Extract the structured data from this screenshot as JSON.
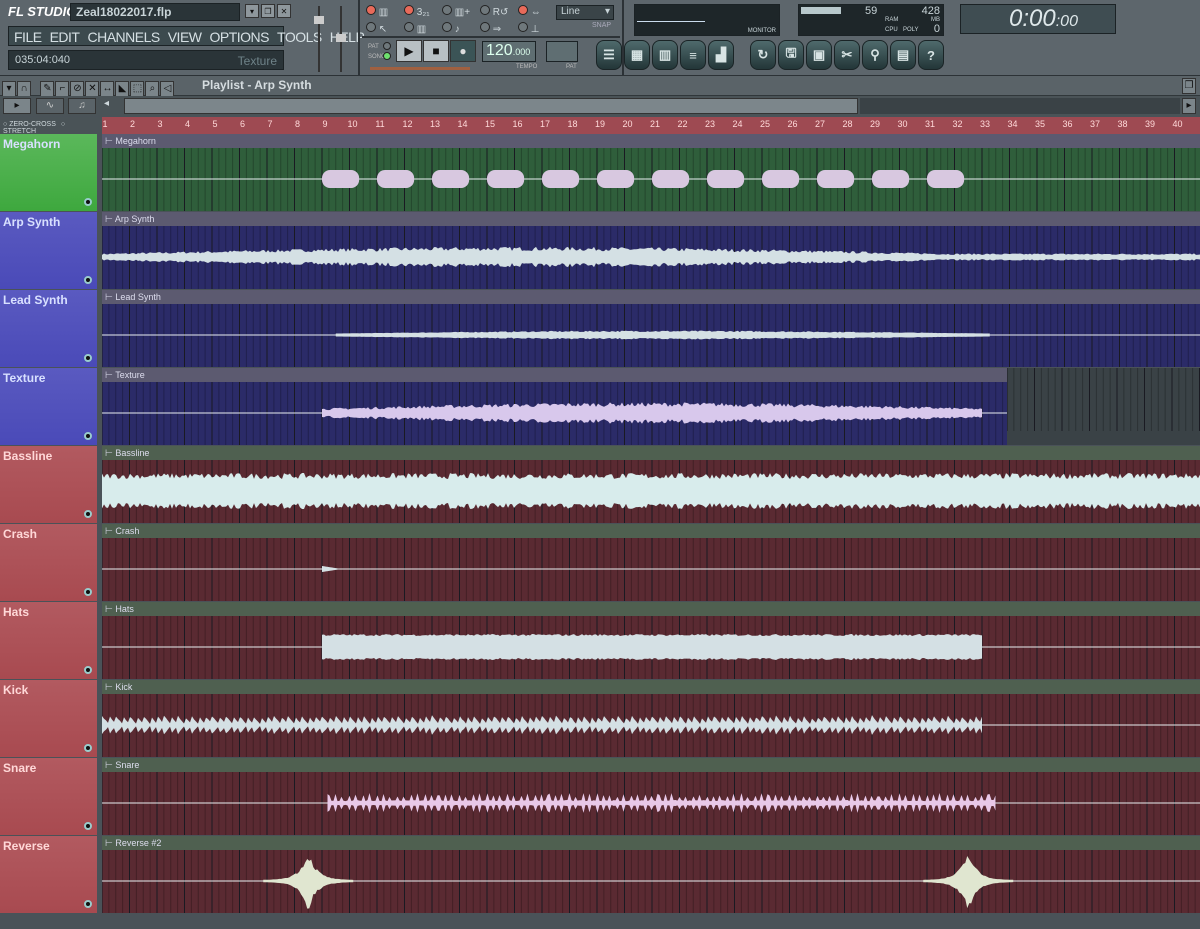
{
  "app": {
    "logo": "FL STUDIO",
    "project_file": "Zeal18022017.flp",
    "menu": [
      "FILE",
      "EDIT",
      "CHANNELS",
      "VIEW",
      "OPTIONS",
      "TOOLS",
      "HELP"
    ],
    "hint_time": "035:04:040",
    "hint_text": "Texture"
  },
  "transport": {
    "pat_label": "PAT",
    "song_label": "SONG",
    "mode": "song",
    "tempo": "120",
    "tempo_frac": ".000",
    "tempo_label": "TEMPO",
    "pat_label2": "PAT",
    "snap": "Line",
    "snap_label": "SNAP",
    "monitor_label": "MONITOR"
  },
  "meters": {
    "cpu": "59",
    "ram": "428",
    "ram_label": "RAM",
    "mb_label": "MB",
    "cpu_label": "CPU",
    "poly_label": "POLY",
    "poly": "0",
    "cpu_percent": 59
  },
  "clock": {
    "time": "0:00",
    "frames": ":00"
  },
  "playlist": {
    "title": "Playlist - Arp Synth",
    "zero_cross": "ZERO-CROSS",
    "stretch": "STRETCH",
    "bars": 40
  },
  "colors": {
    "green": "#3ea83e",
    "blue": "#4a4ab8",
    "red": "#a84a50"
  },
  "tracks": [
    {
      "name": "Megahorn",
      "clip": "Megahorn",
      "color": "green",
      "end": 40,
      "wave": "blobs",
      "ws": 9,
      "we": 33
    },
    {
      "name": "Arp Synth",
      "clip": "Arp Synth",
      "color": "blue",
      "end": 40,
      "wave": "swell",
      "ws": 1,
      "we": 41
    },
    {
      "name": "Lead Synth",
      "clip": "Lead Synth",
      "color": "blue",
      "end": 40,
      "wave": "thin",
      "ws": 9.5,
      "we": 33.3
    },
    {
      "name": "Texture",
      "clip": "Texture",
      "color": "blue",
      "end": 32.9,
      "wave": "swell",
      "ws": 9,
      "we": 33
    },
    {
      "name": "Bassline",
      "clip": "Bassline",
      "color": "red",
      "end": 40,
      "wave": "loud",
      "ws": 1,
      "we": 41
    },
    {
      "name": "Crash",
      "clip": "Crash",
      "color": "red",
      "end": 40,
      "wave": "blip",
      "ws": 9,
      "we": 9.7
    },
    {
      "name": "Hats",
      "clip": "Hats",
      "color": "red",
      "end": 40,
      "wave": "block",
      "ws": 9,
      "we": 33
    },
    {
      "name": "Kick",
      "clip": "Kick",
      "color": "red",
      "end": 40,
      "wave": "kick",
      "ws": 1,
      "we": 33
    },
    {
      "name": "Snare",
      "clip": "Snare",
      "color": "red",
      "end": 40,
      "wave": "snare",
      "ws": 9.2,
      "we": 33.5
    },
    {
      "name": "Reverse",
      "clip": "Reverse #2",
      "color": "red",
      "end": 40,
      "wave": "reverse",
      "ws": 8.5,
      "we": 32.5
    }
  ]
}
